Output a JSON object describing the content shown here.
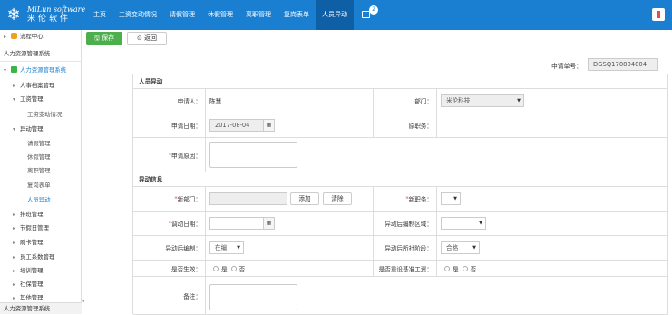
{
  "brand": {
    "en": "MiLun software",
    "cn": "米伦软件"
  },
  "nav": {
    "items": [
      "主页",
      "工资变动情况",
      "请假管理",
      "休假管理",
      "离职管理",
      "复岗表单",
      "人员异动"
    ],
    "badge": "2"
  },
  "sidebar": {
    "flow_center": "流程中心",
    "system_title": "人力资源管理系统",
    "hr_system": "人力资源管理系统",
    "items": [
      "人事档案管理",
      "工资管理",
      "工资变动情况",
      "异动管理",
      "请假管理",
      "休假管理",
      "离职管理",
      "复岗表单",
      "人员异动",
      "排班管理",
      "节假日管理",
      "刷卡管理",
      "员工系数管理",
      "培训管理",
      "社保管理",
      "其他管理"
    ],
    "bottom": "人力资源管理系统"
  },
  "toolbar": {
    "save": "保存",
    "back": "返回"
  },
  "app_no": {
    "label": "申请单号：",
    "value": "DGSQ170804004"
  },
  "form": {
    "section1": "人员异动",
    "applicant_label": "申请人：",
    "applicant": "陈慧",
    "dept_label": "部门：",
    "dept": "米伦科技",
    "date_label": "申请日期：",
    "date": "2017-08-04",
    "orig_post_label": "原职务：",
    "reason_label": "申请原因：",
    "section2": "异动信息",
    "new_dept_label": "新部门：",
    "add_btn": "添加",
    "clear_btn": "清除",
    "new_post_label": "新职务：",
    "transfer_date_label": "调动日期：",
    "after_org_label": "异动后编制区域：",
    "after_staff_label": "异动后编制：",
    "after_staff": "在编",
    "after_ss_label": "异动后所社阶段：",
    "after_ss": "合格",
    "effect_label": "是否生效：",
    "reset_salary_label": "是否重设基准工资：",
    "yes": "是",
    "no": "否",
    "remark_label": "备注："
  }
}
